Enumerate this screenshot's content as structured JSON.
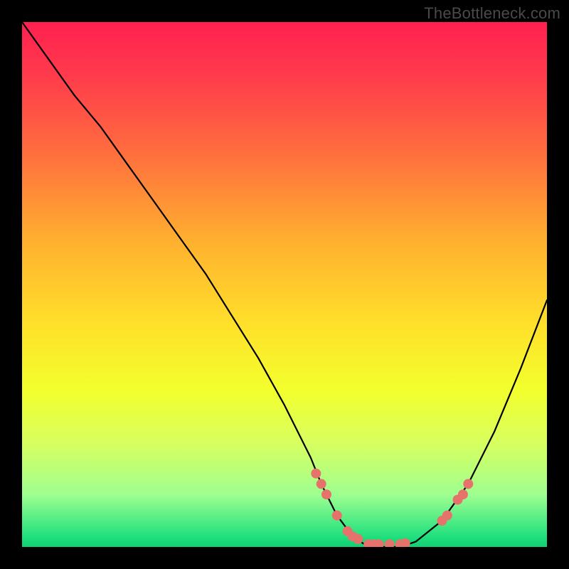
{
  "watermark": "TheBottleneck.com",
  "chart_data": {
    "type": "line",
    "title": "",
    "xlabel": "",
    "ylabel": "",
    "xlim": [
      0,
      100
    ],
    "ylim": [
      0,
      100
    ],
    "grid": false,
    "legend": false,
    "series": [
      {
        "name": "curve",
        "x": [
          0,
          5,
          10,
          15,
          20,
          25,
          30,
          35,
          40,
          45,
          50,
          55,
          57,
          60,
          63,
          66,
          69,
          72,
          75,
          80,
          85,
          90,
          95,
          100
        ],
        "y": [
          100,
          93,
          86,
          80,
          73,
          66,
          59,
          52,
          44,
          36,
          27,
          17,
          12,
          6,
          2,
          0,
          0,
          0,
          1,
          5,
          12,
          22,
          34,
          47
        ]
      }
    ],
    "markers": {
      "name": "dots",
      "x": [
        56,
        57,
        58,
        60,
        62,
        63,
        64,
        66,
        67,
        68,
        70,
        72,
        73,
        80,
        81,
        83,
        84,
        85
      ],
      "y": [
        14,
        12,
        10,
        6,
        3,
        2,
        1.5,
        0.5,
        0.5,
        0.5,
        0.5,
        0.5,
        0.7,
        5,
        6,
        9,
        10,
        12
      ]
    },
    "background": {
      "type": "vertical-gradient",
      "stops": [
        {
          "pos": 0,
          "color": "#ff2050"
        },
        {
          "pos": 25,
          "color": "#ff6e3e"
        },
        {
          "pos": 58,
          "color": "#ffe12a"
        },
        {
          "pos": 90,
          "color": "#9fff90"
        },
        {
          "pos": 100,
          "color": "#11cf73"
        }
      ]
    }
  }
}
